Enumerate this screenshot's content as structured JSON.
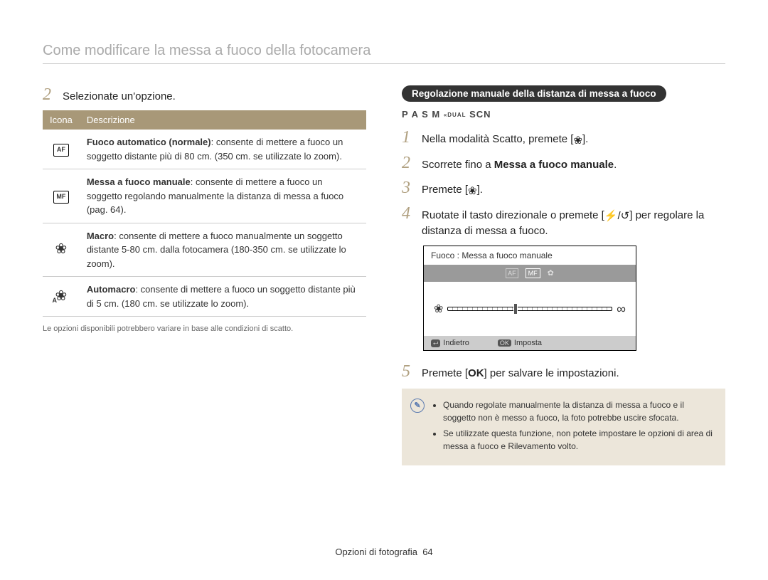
{
  "pageTitle": "Come modificare la messa a fuoco della fotocamera",
  "leftCol": {
    "step2": {
      "num": "2",
      "text": "Selezionate un'opzione."
    },
    "tableHeaders": {
      "icon": "Icona",
      "desc": "Descrizione"
    },
    "rows": [
      {
        "iconLabel": "AF",
        "bold": "Fuoco automatico (normale)",
        "text": ": consente di mettere a fuoco un soggetto distante più di 80 cm. (350 cm. se utilizzate lo zoom)."
      },
      {
        "iconLabel": "MF",
        "bold": "Messa a fuoco manuale",
        "text": ": consente di mettere a fuoco un soggetto regolando manualmente la distanza di messa a fuoco (pag. 64)."
      },
      {
        "iconType": "flower",
        "bold": "Macro",
        "text": ": consente di mettere a fuoco manualmente un soggetto distante 5-80 cm. dalla fotocamera (180-350 cm. se utilizzate lo zoom)."
      },
      {
        "iconType": "flower-a",
        "bold": "Automacro",
        "text": ": consente di mettere a fuoco un soggetto distante più di 5 cm. (180 cm. se utilizzate lo zoom)."
      }
    ],
    "footnote": "Le opzioni disponibili potrebbero variare in base alle condizioni di scatto."
  },
  "rightCol": {
    "sectionHeader": "Regolazione manuale della distanza di messa a fuoco",
    "modes": "P A S M",
    "modeDual": "DUAL",
    "modeScn": "SCN",
    "steps": [
      {
        "num": "1",
        "pre": "Nella modalità Scatto, premete [",
        "iconType": "flower",
        "post": "]."
      },
      {
        "num": "2",
        "pre": "Scorrete fino a ",
        "bold": "Messa a fuoco manuale",
        "post": "."
      },
      {
        "num": "3",
        "pre": "Premete [",
        "iconType": "flower",
        "post": "]."
      },
      {
        "num": "4",
        "pre": "Ruotate il tasto direzionale o premete [",
        "iconType": "flash-timer",
        "post": "] per regolare la distanza di messa a fuoco."
      },
      {
        "num": "5",
        "pre": "Premete [",
        "iconType": "ok",
        "post": "] per salvare le impostazioni."
      }
    ],
    "lcd": {
      "title": "Fuoco : Messa a fuoco manuale",
      "barLabels": [
        "AF",
        "MF",
        "✿"
      ],
      "back": "Indietro",
      "set": "Imposta",
      "okLabel": "OK"
    },
    "note": {
      "items": [
        "Quando regolate manualmente la distanza di messa a fuoco e il soggetto non è messo a fuoco, la foto potrebbe uscire sfocata.",
        "Se utilizzate questa funzione, non potete impostare le opzioni di area di messa a fuoco e Rilevamento volto."
      ]
    }
  },
  "footer": {
    "section": "Opzioni di fotografia",
    "page": "64"
  }
}
